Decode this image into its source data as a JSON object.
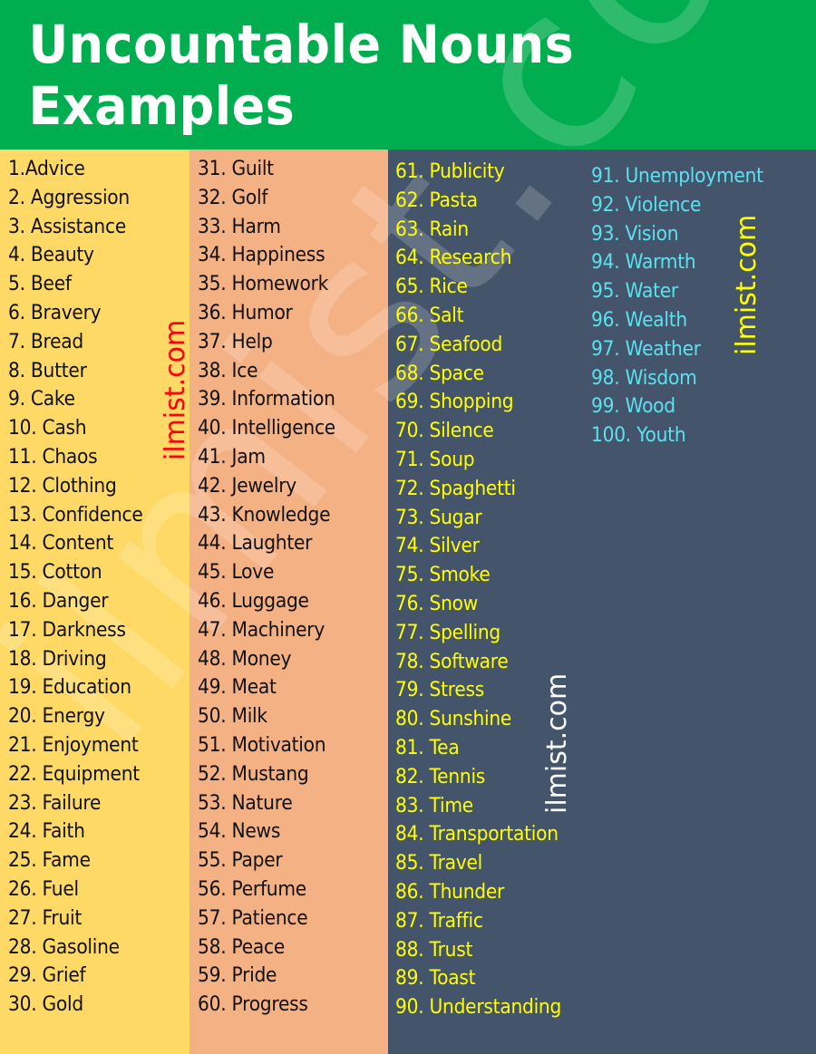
{
  "header": {
    "title": "Uncountable Nouns Examples"
  },
  "colors": {
    "header_bg": "#00ad4f",
    "column_1_bg": "#ffd966",
    "column_2_bg": "#f4b183",
    "column_3_bg": "#44546a",
    "column_1_text": "#111111",
    "column_2_text": "#111111",
    "column_3_text": "#ffff00",
    "column_4_text": "#5ce1f0"
  },
  "watermarks": {
    "red": "ilmist.com",
    "white": "ilmist.com",
    "yellow": "ilmist.com",
    "background": "ilmist.com"
  },
  "columns": [
    {
      "items": [
        "1.Advice",
        "2. Aggression",
        "3. Assistance",
        "4. Beauty",
        "5. Beef",
        "6. Bravery",
        "7. Bread",
        "8. Butter",
        "9. Cake",
        "10. Cash",
        "11. Chaos",
        "12. Clothing",
        "13. Confidence",
        "14. Content",
        "15. Cotton",
        "16. Danger",
        "17. Darkness",
        "18. Driving",
        "19. Education",
        "20. Energy",
        "21. Enjoyment",
        "22. Equipment",
        "23. Failure",
        "24. Faith",
        "25. Fame",
        "26. Fuel",
        "27. Fruit",
        "28. Gasoline",
        "29. Grief",
        "30. Gold"
      ]
    },
    {
      "items": [
        "31. Guilt",
        "32. Golf",
        "33. Harm",
        "34. Happiness",
        "35. Homework",
        "36. Humor",
        "37. Help",
        "38. Ice",
        "39. Information",
        "40. Intelligence",
        "41. Jam",
        "42. Jewelry",
        "43. Knowledge",
        "44. Laughter",
        "45. Love",
        "46. Luggage",
        "47. Machinery",
        "48. Money",
        "49. Meat",
        "50. Milk",
        "51. Motivation",
        "52. Mustang",
        "53. Nature",
        "54. News",
        "55. Paper",
        "56. Perfume",
        "57. Patience",
        "58. Peace",
        "59. Pride",
        "60. Progress"
      ]
    },
    {
      "items": [
        "61. Publicity",
        "62. Pasta",
        "63. Rain",
        "64. Research",
        "65. Rice",
        "66. Salt",
        "67. Seafood",
        "68. Space",
        "69. Shopping",
        "70. Silence",
        "71. Soup",
        "72. Spaghetti",
        "73. Sugar",
        "74. Silver",
        "75. Smoke",
        "76. Snow",
        "77. Spelling",
        "78. Software",
        "79. Stress",
        "80. Sunshine",
        "81. Tea",
        "82. Tennis",
        "83. Time",
        "84. Transportation",
        "85. Travel",
        "86. Thunder",
        "87. Traffic",
        "88. Trust",
        "89. Toast",
        "90. Understanding"
      ]
    },
    {
      "items": [
        "91. Unemployment",
        "92. Violence",
        "93. Vision",
        "94. Warmth",
        "95. Water",
        "96. Wealth",
        "97. Weather",
        "98. Wisdom",
        "99. Wood",
        "100. Youth"
      ]
    }
  ]
}
